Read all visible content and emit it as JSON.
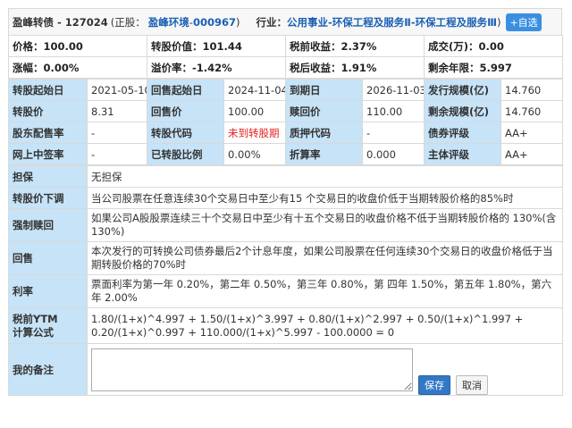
{
  "header": {
    "bond_name": "盈峰转债 - 127024",
    "stock_prefix": "(正股：",
    "stock_name": "盈峰环境",
    "stock_sep": " - ",
    "stock_code": "000967",
    "stock_suffix": ")",
    "industry_label": "行业：",
    "industry": "公用事业-环保工程及服务Ⅱ-环保工程及服务Ⅲ",
    "industry_suffix": ")",
    "add_button": "+自选"
  },
  "quote": [
    [
      "价格：100.00",
      "转股价值：101.44",
      "税前收益：2.37%",
      "成交(万)：0.00"
    ],
    [
      "涨幅：0.00%",
      "溢价率：-1.42%",
      "税后收益：1.91%",
      "剩余年限：5.997"
    ]
  ],
  "info": [
    [
      {
        "l": "转股起始日",
        "v": "2021-05-10"
      },
      {
        "l": "回售起始日",
        "v": "2024-11-04"
      },
      {
        "l": "到期日",
        "v": "2026-11-03"
      },
      {
        "l": "发行规模(亿)",
        "v": "14.760"
      }
    ],
    [
      {
        "l": "转股价",
        "v": "8.31"
      },
      {
        "l": "回售价",
        "v": "100.00"
      },
      {
        "l": "赎回价",
        "v": "110.00"
      },
      {
        "l": "剩余规模(亿)",
        "v": "14.760"
      }
    ],
    [
      {
        "l": "股东配售率",
        "v": "-"
      },
      {
        "l": "转股代码",
        "v": "未到转股期"
      },
      {
        "l": "质押代码",
        "v": "-"
      },
      {
        "l": "债券评级",
        "v": "AA+"
      }
    ],
    [
      {
        "l": "网上中签率",
        "v": "-"
      },
      {
        "l": "已转股比例",
        "v": "0.00%"
      },
      {
        "l": "折算率",
        "v": "0.000"
      },
      {
        "l": "主体评级",
        "v": "AA+"
      }
    ]
  ],
  "terms": {
    "guarantee_label": "担保",
    "guarantee": "无担保",
    "down_label": "转股价下调",
    "down": "当公司股票在任意连续30个交易日中至少有15 个交易日的收盘价低于当期转股价格的85%时",
    "redeem_label": "强制赎回",
    "redeem": "如果公司A股股票连续三十个交易日中至少有十五个交易日的收盘价格不低于当期转股价格的 130%(含 130%)",
    "putback_label": "回售",
    "putback": "本次发行的可转换公司债券最后2个计息年度，如果公司股票在任何连续30个交易日的收盘价格低于当期转股价格的70%时",
    "rate_label": "利率",
    "rate": "票面利率为第一年 0.20%，第二年 0.50%，第三年 0.80%，第 四年 1.50%，第五年 1.80%，第六年 2.00%",
    "ytm_label_1": "税前YTM",
    "ytm_label_2": "计算公式",
    "ytm": "1.80/(1+x)^4.997 + 1.50/(1+x)^3.997 + 0.80/(1+x)^2.997 + 0.50/(1+x)^1.997 + 0.20/(1+x)^0.997 + 110.000/(1+x)^5.997 - 100.0000 = 0",
    "memo_label": "我的备注",
    "memo_value": "",
    "save_button": "保存",
    "cancel_button": "取消"
  },
  "colors": {
    "label_bg": "#c6e3f7",
    "link": "#1a5fb4",
    "warning": "#e02020",
    "primary_button": "#3378c5"
  }
}
